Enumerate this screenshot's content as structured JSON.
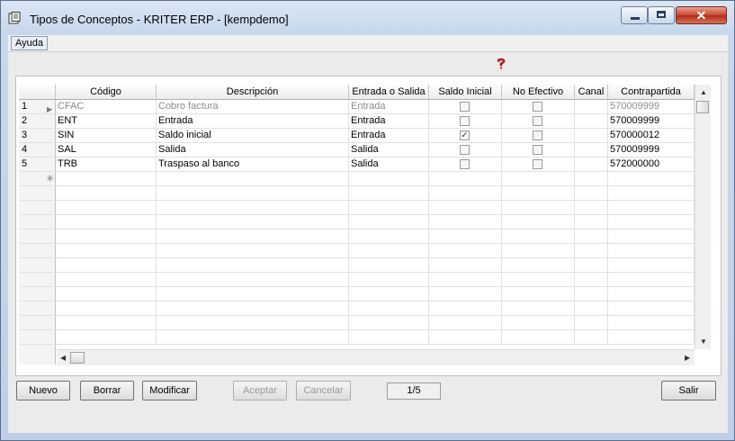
{
  "window": {
    "title": "Tipos de Conceptos - KRITER ERP - [kempdemo]",
    "close_glyph": "✕"
  },
  "menu": {
    "items": [
      {
        "label": "Ayuda"
      }
    ]
  },
  "grid": {
    "columns": [
      "Código",
      "Descripción",
      "Entrada o Salida",
      "Saldo Inicial",
      "No Efectivo",
      "Canal",
      "Contrapartida"
    ],
    "rows": [
      {
        "num": "1",
        "codigo": "CFAC",
        "descripcion": "Cobro factura",
        "entrada_salida": "Entrada",
        "saldo_inicial": false,
        "no_efectivo": false,
        "canal": "",
        "contrapartida": "570009999"
      },
      {
        "num": "2",
        "codigo": "ENT",
        "descripcion": "Entrada",
        "entrada_salida": "Entrada",
        "saldo_inicial": false,
        "no_efectivo": false,
        "canal": "",
        "contrapartida": "570009999"
      },
      {
        "num": "3",
        "codigo": "SIN",
        "descripcion": "Saldo inicial",
        "entrada_salida": "Entrada",
        "saldo_inicial": true,
        "no_efectivo": false,
        "canal": "",
        "contrapartida": "570000012"
      },
      {
        "num": "4",
        "codigo": "SAL",
        "descripcion": "Salida",
        "entrada_salida": "Salida",
        "saldo_inicial": false,
        "no_efectivo": false,
        "canal": "",
        "contrapartida": "570009999"
      },
      {
        "num": "5",
        "codigo": "TRB",
        "descripcion": "Traspaso al banco",
        "entrada_salida": "Salida",
        "saldo_inicial": false,
        "no_efectivo": false,
        "canal": "",
        "contrapartida": "572000000"
      }
    ],
    "check_glyph": "✓",
    "current_row_glyph": "▶",
    "new_row_glyph": "✳",
    "empty_rows": 11
  },
  "buttons": {
    "nuevo": "Nuevo",
    "borrar": "Borrar",
    "modificar": "Modificar",
    "aceptar": "Aceptar",
    "cancelar": "Cancelar",
    "salir": "Salir"
  },
  "record_counter": "1/5",
  "icons": {
    "app": "document-window-icon",
    "help": "help-question-icon"
  },
  "colors": {
    "titlebar": "#c8d8ec",
    "close_button": "#c8452f",
    "help_icon": "#cc1f1f"
  }
}
